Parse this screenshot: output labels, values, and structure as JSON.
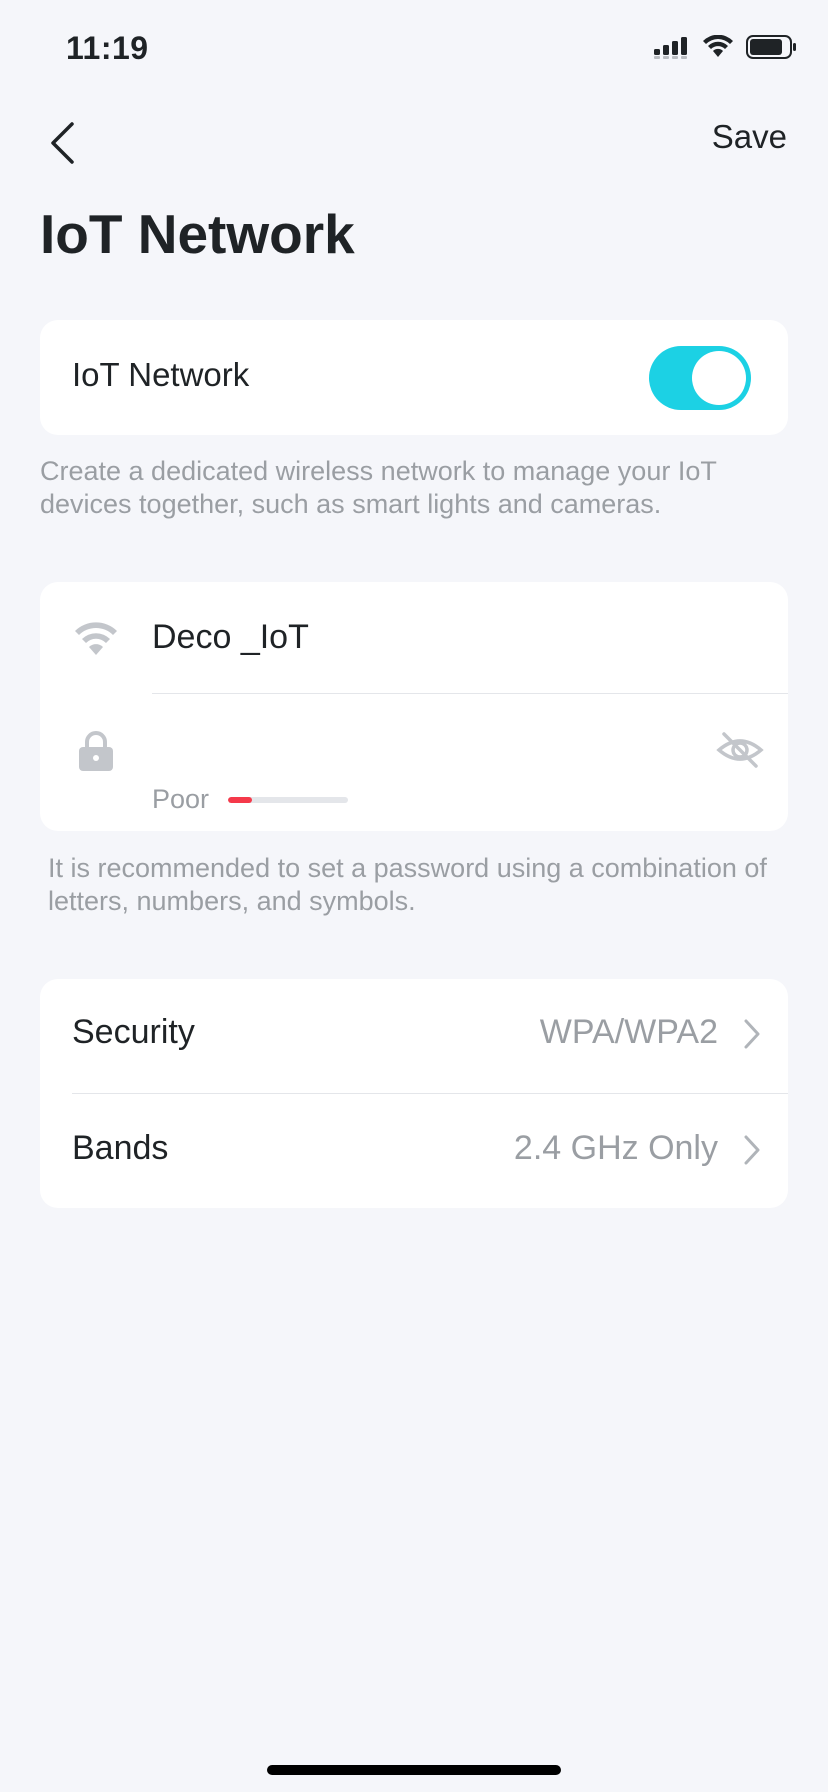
{
  "status_bar": {
    "time": "11:19"
  },
  "nav": {
    "save_label": "Save"
  },
  "page": {
    "title": "IoT Network"
  },
  "iot_toggle": {
    "label": "IoT Network",
    "enabled": true,
    "description": "Create a dedicated wireless network to manage your IoT devices together, such as smart lights and cameras."
  },
  "wifi": {
    "ssid": "Deco _IoT",
    "password": "",
    "strength_label": "Poor",
    "strength_level": 0.2,
    "hint": "It is recommended to set a password using a combination of letters, numbers, and symbols."
  },
  "settings": {
    "rows": [
      {
        "label": "Security",
        "value": "WPA/WPA2"
      },
      {
        "label": "Bands",
        "value": "2.4 GHz Only"
      }
    ]
  },
  "colors": {
    "accent": "#1cd1e4",
    "strength_poor": "#f5394a",
    "background": "#f5f6fa"
  },
  "icons": {
    "back": "chevron-left-icon",
    "ssid": "wifi-icon",
    "password": "lock-icon",
    "visibility": "eye-slash-icon",
    "row_arrow": "chevron-right-icon"
  }
}
